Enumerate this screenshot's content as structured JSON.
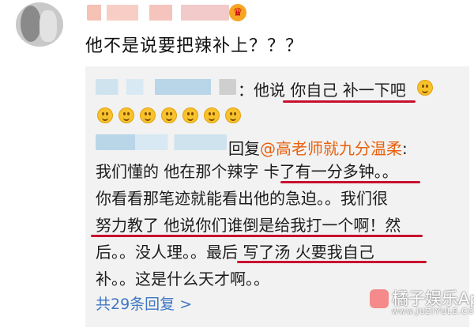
{
  "comment": {
    "text": "他不是说要把辣补上？？？"
  },
  "reply_first": {
    "text_before": "：他说 ",
    "quote": "你自己 补一下吧"
  },
  "reply_second": {
    "prefix": "回复",
    "mention": "@高老师就九分温柔",
    "colon": ":",
    "lines": [
      "我们懂的 他在那个辣字 卡了有一分多钟。。",
      "你看看那笔迹就能看出他的急迫。。我们很",
      "努力教了 他说你们谁倒是给我打一个啊！然",
      "后。。没人理。。最后 写了汤 火要我自己",
      "补。。这是什么天才啊。。"
    ]
  },
  "total_replies": "共29条回复 >",
  "watermark": {
    "title": "橘子娱乐App",
    "subtitle": "www.JUZIYULE.COM"
  },
  "colors": {
    "mention": "#e8600d",
    "link": "#3f77c2",
    "underline": "#c8102e",
    "reply_bg": "#f2f2f2"
  },
  "icons": [
    "avatar",
    "vip-crown-icon",
    "smile-emoji-icon",
    "juzi-logo-icon"
  ]
}
